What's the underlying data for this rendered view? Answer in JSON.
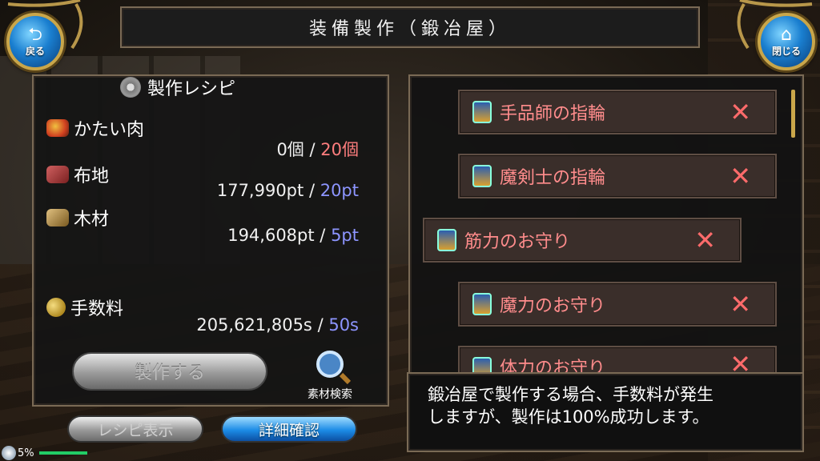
{
  "header": {
    "title": "装備製作（鍛冶屋）"
  },
  "back_button": {
    "label": "戻る",
    "icon": "return-arrow-icon"
  },
  "close_button": {
    "label": "閉じる",
    "icon": "home-icon"
  },
  "recipe": {
    "title": "製作レシピ",
    "materials": [
      {
        "name": "かたい肉",
        "have": "0個",
        "need": "20個",
        "need_color": "#ff7e7e"
      },
      {
        "name": "布地",
        "have": "177,990pt",
        "need": "20pt",
        "need_color": "#8d95ff"
      },
      {
        "name": "木材",
        "have": "194,608pt",
        "need": "5pt",
        "need_color": "#8d95ff"
      }
    ],
    "fee": {
      "name": "手数料",
      "have": "205,621,805s",
      "need": "50s",
      "need_color": "#8d95ff"
    },
    "separator": "/"
  },
  "actions": {
    "craft_label": "製作する",
    "material_search_label": "素材検索",
    "show_recipe_label": "レシピ表示",
    "detail_label": "詳細確認"
  },
  "status": {
    "percent": "5%"
  },
  "item_list": [
    {
      "name": "手品師の指輪",
      "mark": "✕"
    },
    {
      "name": "魔剣士の指輪",
      "mark": "✕"
    },
    {
      "name": "筋力のお守り",
      "mark": "✕",
      "selected": true
    },
    {
      "name": "魔力のお守り",
      "mark": "✕"
    },
    {
      "name": "体力のお守り",
      "mark": "✕"
    }
  ],
  "message": "鍛冶屋で製作する場合、手数料が発生\nしますが、製作は100%成功します。"
}
